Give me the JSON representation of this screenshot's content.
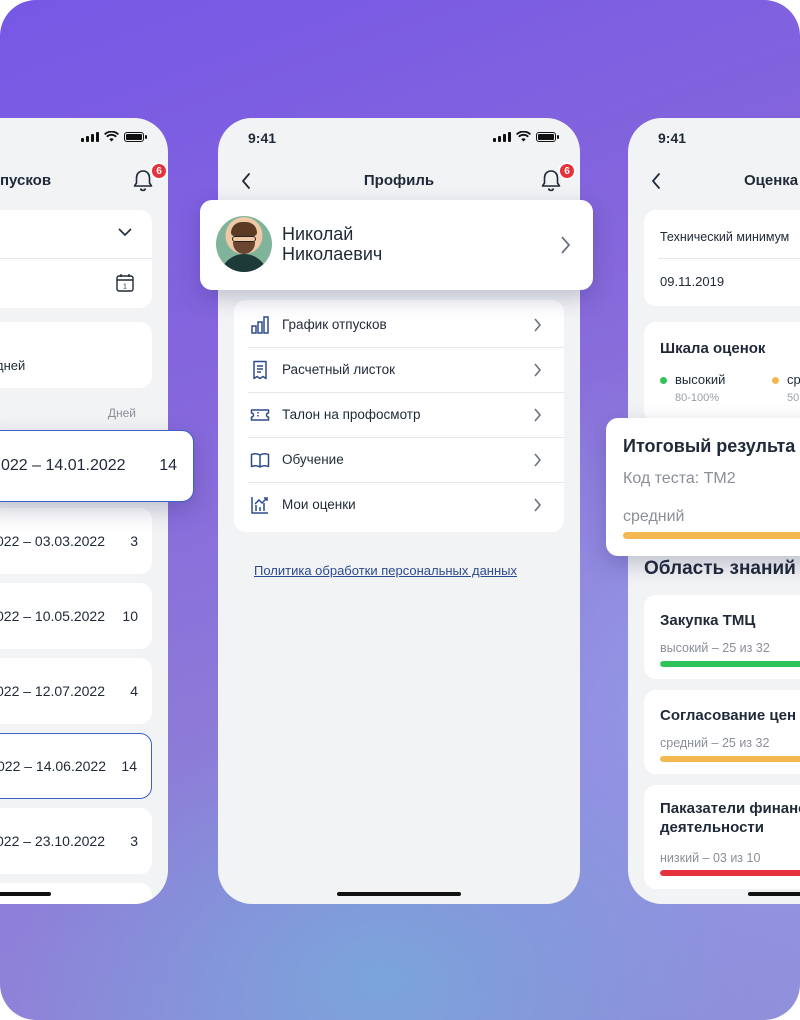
{
  "status": {
    "time": "9:41"
  },
  "notifications": {
    "count": "6"
  },
  "left_phone": {
    "title": "пусков",
    "field_2_text": "",
    "total_text": "дней",
    "days_header": "Дней",
    "highlight": {
      "range": "022 – 14.01.2022",
      "days": "14"
    },
    "rows": [
      {
        "range": "022 – 03.03.2022",
        "days": "3"
      },
      {
        "range": "022 – 10.05.2022",
        "days": "10"
      },
      {
        "range": "022 – 12.07.2022",
        "days": "4"
      },
      {
        "range": "022 – 14.06.2022",
        "days": "14"
      },
      {
        "range": "022 – 23.10.2022",
        "days": "3"
      }
    ]
  },
  "profile": {
    "title": "Профиль",
    "name_line1": "Николай",
    "name_line2": "Николаевич",
    "menu": [
      {
        "label": "График отпусков",
        "icon": "bar-chart-icon"
      },
      {
        "label": "Расчетный листок",
        "icon": "receipt-icon"
      },
      {
        "label": "Талон на профосмотр",
        "icon": "ticket-icon"
      },
      {
        "label": "Обучение",
        "icon": "book-icon"
      },
      {
        "label": "Мои оценки",
        "icon": "growth-chart-icon"
      }
    ],
    "policy_link": "Политика обработки персональных данных"
  },
  "assessment": {
    "title": "Оценка",
    "test_name": "Технический минимум",
    "date": "09.11.2019",
    "scale_title": "Шкала оценок",
    "scale": [
      {
        "label": "высокий",
        "range": "80-100%",
        "color": "#2fc35a"
      },
      {
        "label": "ср",
        "range": "50",
        "color": "#f3b84f"
      }
    ],
    "result": {
      "title": "Итоговый результа",
      "code": "Код теста: ТМ2",
      "level": "средний",
      "color": "#f3b84f",
      "progress": 1.0
    },
    "knowledge_title": "Область знаний",
    "areas": [
      {
        "title": "Закупка ТМЦ",
        "subtitle": "высокий – 25 из 32",
        "color": "#2fc35a",
        "progress": 1.0
      },
      {
        "title": "Согласование цен",
        "subtitle": "средний – 25 из 32",
        "color": "#f3b84f",
        "progress": 1.0
      },
      {
        "title": "Паказатели финанс",
        "title_line2": "деятельности",
        "subtitle": "низкий – 03 из 10",
        "color": "#e5323c",
        "progress": 0.5
      }
    ]
  }
}
